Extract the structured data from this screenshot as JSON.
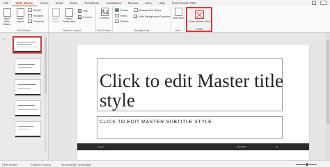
{
  "tabs": [
    "File",
    "Slide Master",
    "Home",
    "Insert",
    "Draw",
    "Transitions",
    "Animations",
    "Review",
    "View",
    "Help",
    "Foxit Reader PDF"
  ],
  "ribbon": {
    "edit_master": {
      "insert_slide_master": "Insert Slide Master",
      "insert_layout": "Insert Layout",
      "delete": "Delete",
      "rename": "Rename",
      "preserve": "Preserve",
      "label": "Edit Master"
    },
    "master_layout": {
      "master_layout_btn": "Master Layout",
      "insert_placeholder": "Insert Placeholder",
      "title": "Title",
      "footers": "Footers",
      "label": "Master Layout"
    },
    "edit_theme": {
      "themes": "Themes",
      "label": "Edit Theme"
    },
    "background": {
      "colors": "Colors",
      "fonts": "Fonts",
      "effects": "Effects",
      "background_styles": "Background Styles",
      "hide_background_graphics": "Hide Background Graphics",
      "label": "Background"
    },
    "size": {
      "slide_size": "Slide Size",
      "label": "Size"
    },
    "close": {
      "close_master_view": "Close Master View",
      "label": "Close"
    }
  },
  "thumbnails": {
    "numbers": [
      "1"
    ],
    "count": 5
  },
  "slide": {
    "title": "Click to edit Master title style",
    "subtitle": "CLICK TO EDIT MASTER SUBTITLE STYLE",
    "footer_left": "Footer",
    "footer_date": "4/01/2024",
    "footer_page": "‹#›"
  },
  "status": {
    "mode": "Slide Master",
    "language": "English (Ghana)",
    "accessibility": "Accessibility: Investigate"
  },
  "colors": {
    "accent": "#b7472a",
    "highlight": "#d93636"
  }
}
